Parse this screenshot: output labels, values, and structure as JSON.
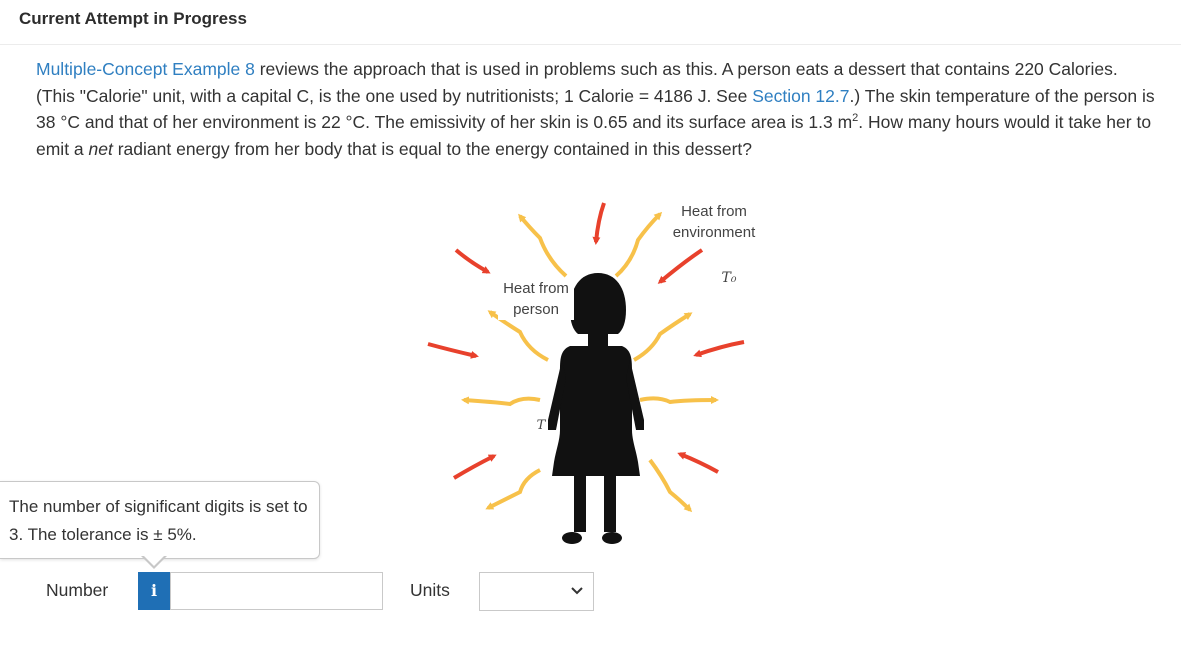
{
  "header": {
    "title": "Current Attempt in Progress"
  },
  "question": {
    "link1": "Multiple-Concept Example 8",
    "text1": " reviews the approach that is used in problems such as this. A person eats a dessert that contains 220 Calories. (This \"Calorie\" unit, with a capital C, is the one used by nutritionists; 1 Calorie = 4186 J. See ",
    "link2": "Section 12.7",
    "text2": ".) The skin temperature of the person is 38 °C and that of her environment is 22 °C. The emissivity of her skin is 0.65 and its surface area is 1.3 m",
    "sup": "2",
    "text3": ". How many hours would it take her to emit a ",
    "italic": "net",
    "text4": " radiant energy from her body that is equal to the energy contained in this dessert?"
  },
  "figure": {
    "label_environment": "Heat from environment",
    "label_person": "Heat from person",
    "label_t0": "T₀",
    "label_t": "T",
    "colors": {
      "environment_arrow": "#e8412c",
      "person_arrow": "#f7c14a",
      "silhouette": "#111111"
    }
  },
  "tooltip": {
    "text": "The number of significant digits is set to 3. The tolerance is ± 5%."
  },
  "answer": {
    "number_label": "Number",
    "info_icon": "i",
    "number_value": "",
    "units_label": "Units",
    "units_selected": ""
  }
}
